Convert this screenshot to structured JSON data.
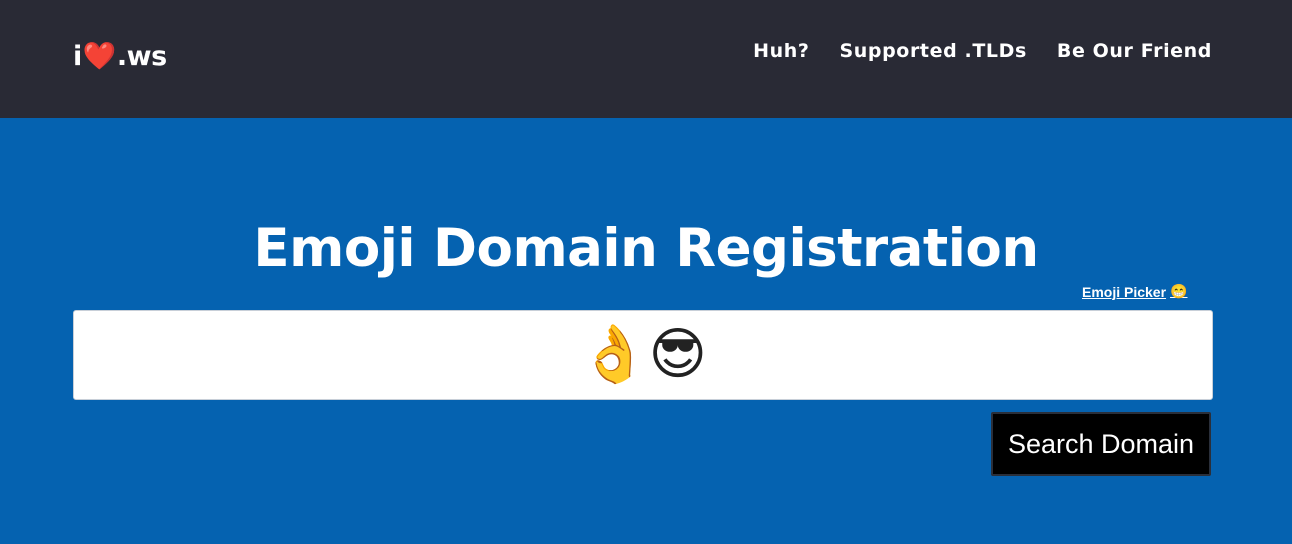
{
  "header": {
    "logo": {
      "prefix": "i",
      "heart": "❤️",
      "suffix": ".ws"
    },
    "nav": [
      {
        "label": "Huh?"
      },
      {
        "label": "Supported .TLDs"
      },
      {
        "label": "Be Our Friend"
      }
    ]
  },
  "hero": {
    "title": "Emoji Domain Registration",
    "emoji_picker": {
      "label": "Emoji Picker",
      "emoji": "😁"
    },
    "search": {
      "value": "👌😎"
    },
    "search_button": "Search Domain"
  },
  "colors": {
    "header_bg": "#292a35",
    "hero_bg": "#0562b0",
    "button_bg": "#000000"
  }
}
